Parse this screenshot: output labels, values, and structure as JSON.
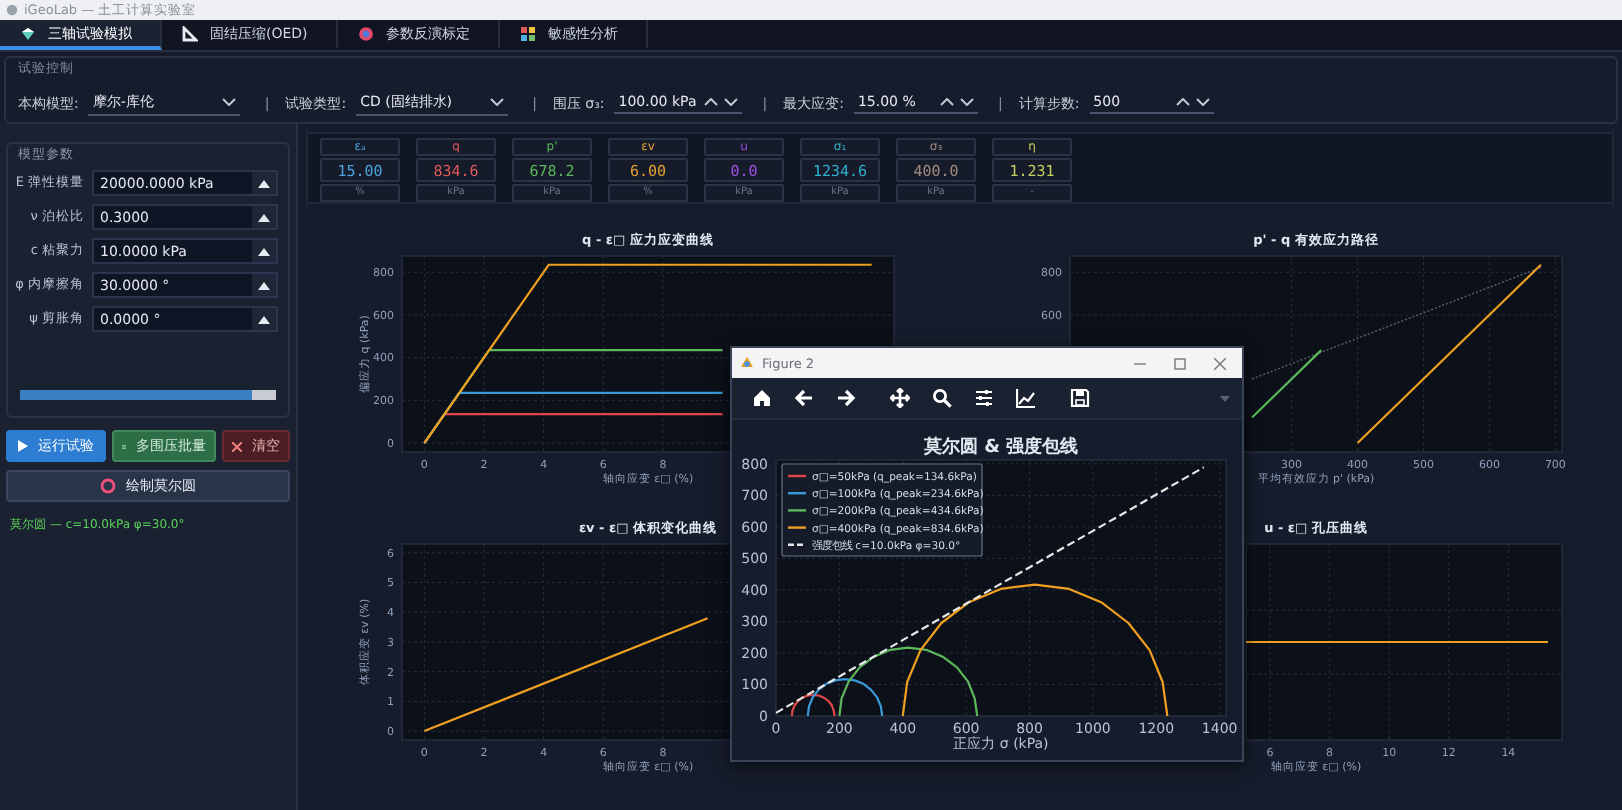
{
  "window": {
    "title": "iGeoLab — 土工计算实验室"
  },
  "tabs": [
    {
      "label": "三轴试验模拟",
      "selected": true
    },
    {
      "label": "固结压缩(OED)",
      "selected": false
    },
    {
      "label": "参数反演标定",
      "selected": false
    },
    {
      "label": "敏感性分析",
      "selected": false
    }
  ],
  "test_control": {
    "title": "试验控制",
    "fields": [
      {
        "kind": "dropdown",
        "label": "本构模型:",
        "value": "摩尔-库伦"
      },
      {
        "kind": "dropdown",
        "separator": "|",
        "label": "试验类型:",
        "value": "CD (固结排水)"
      },
      {
        "kind": "spinbox",
        "separator": "|",
        "label": "围压 σ₃:",
        "value": "100.00  kPa"
      },
      {
        "kind": "spinbox",
        "separator": "|",
        "label": "最大应变:",
        "value": "15.00  %"
      },
      {
        "kind": "spinbox",
        "separator": "|",
        "label": "计算步数:",
        "value": "500"
      }
    ]
  },
  "model_params": {
    "title": "模型参数",
    "rows": [
      {
        "label": "E  弹性模量",
        "value": "20000.0000  kPa"
      },
      {
        "label": "ν  泊松比",
        "value": "0.3000"
      },
      {
        "label": "c  粘聚力",
        "value": "10.0000  kPa"
      },
      {
        "label": "φ  内摩擦角",
        "value": "30.0000  °"
      },
      {
        "label": "ψ  剪胀角",
        "value": "0.0000  °"
      }
    ],
    "progress": {
      "level": 0.91
    }
  },
  "actions": [
    {
      "kind": "run",
      "label": "运行试验"
    },
    {
      "kind": "batch",
      "label": "多围压批量"
    },
    {
      "kind": "clear",
      "label": "清空"
    },
    {
      "kind": "mohr",
      "label": "绘制莫尔圆"
    }
  ],
  "status": "莫尔圆 — c=10.0kPa  φ=30.0°",
  "metrics": [
    {
      "label": "εₐ",
      "value": "15.00",
      "unit": "%",
      "color": "#4aa3df"
    },
    {
      "label": "q",
      "value": "834.6",
      "unit": "kPa",
      "color": "#e05a5a"
    },
    {
      "label": "p'",
      "value": "678.2",
      "unit": "kPa",
      "color": "#5cb85c"
    },
    {
      "label": "εv",
      "value": "6.00",
      "unit": "%",
      "color": "#e8a030"
    },
    {
      "label": "u",
      "value": "0.0",
      "unit": "kPa",
      "color": "#a050e0"
    },
    {
      "label": "σ₁",
      "value": "1234.6",
      "unit": "kPa",
      "color": "#30b0d0"
    },
    {
      "label": "σ₃",
      "value": "400.0",
      "unit": "kPa",
      "color": "#a08a80"
    },
    {
      "label": "η",
      "value": "1.231",
      "unit": "-",
      "color": "#c8d060"
    }
  ],
  "charts": [
    {
      "chart_data": {
        "type": "line",
        "title": "q - ε□  应力应变曲线",
        "xlabel": "轴向应变 ε□ (%)",
        "ylabel": "偏应力 q (kPa)",
        "grid": true,
        "xlim": [
          -0.75,
          15.75
        ],
        "ylim": [
          -42,
          876
        ],
        "xticks": [
          0,
          2,
          4,
          6,
          8
        ],
        "yticks": [
          0,
          200,
          400,
          600,
          800
        ],
        "series": [
          {
            "color": "#e04848",
            "x": [
              0,
              0.67,
              10
            ],
            "values": [
              0,
              135,
              135
            ]
          },
          {
            "color": "#3a9ad9",
            "x": [
              0,
              1.17,
              10
            ],
            "values": [
              0,
              235,
              235
            ]
          },
          {
            "color": "#5cb85c",
            "x": [
              0,
              2.17,
              10
            ],
            "values": [
              0,
              435,
              435
            ]
          },
          {
            "color": "#f0a020",
            "x": [
              0,
              4.17,
              15
            ],
            "values": [
              0,
              835,
              835
            ]
          }
        ]
      }
    },
    {
      "chart_data": {
        "type": "line",
        "title": "p' - q  有效应力路径",
        "xlabel": "平均有效应力 p' (kPa)",
        "grid": true,
        "xlim": [
          -36,
          710
        ],
        "ylim": [
          -42,
          876
        ],
        "xticks": [
          300,
          400,
          500,
          600,
          700
        ],
        "yticks": [
          600,
          800
        ],
        "series": [
          {
            "line_style": "dotted",
            "color": "#5a6272",
            "x": [
              240,
              680
            ],
            "values": [
              300,
              825
            ]
          },
          {
            "color": "#5cb85c",
            "x": [
              240,
              345
            ],
            "values": [
              120,
              435
            ]
          },
          {
            "color": "#f0a020",
            "x": [
              400,
              678
            ],
            "values": [
              0,
              835
            ]
          }
        ]
      }
    },
    {
      "chart_data": {
        "type": "line",
        "title": "εv - ε□  体积变化曲线",
        "xlabel": "轴向应变 ε□ (%)",
        "ylabel": "体积应变 εv (%)",
        "grid": true,
        "xlim": [
          -0.75,
          15.75
        ],
        "ylim": [
          -0.3,
          6.3
        ],
        "xticks": [
          0,
          2,
          4,
          6,
          8
        ],
        "yticks": [
          0,
          1,
          2,
          3,
          4,
          5,
          6
        ],
        "series": [
          {
            "color": "#f0a020",
            "x": [
              0,
              9.5
            ],
            "values": [
              0,
              3.8
            ]
          }
        ]
      }
    },
    {
      "title": "u - ε□  孔压曲线",
      "xlabel": "轴向应变 ε□ (%)",
      "axis_numbers": [
        {
          "text": "6"
        },
        {
          "text": "8"
        },
        {
          "text": "10"
        },
        {
          "text": "12"
        },
        {
          "text": "14"
        }
      ]
    }
  ],
  "figure": {
    "title": "Figure 2",
    "chart_data": {
      "type": "line",
      "title": "莫尔圆  &  强度包线",
      "xlabel": "正应力 σ (kPa)",
      "grid": true,
      "legend": "upper left",
      "xlim": [
        0,
        1420
      ],
      "ylim": [
        0,
        812
      ],
      "xticks": [
        0,
        200,
        400,
        600,
        800,
        1000,
        1200,
        1400
      ],
      "yticks": [
        0,
        100,
        200,
        300,
        400,
        500,
        600,
        700,
        800
      ],
      "series": [
        {
          "name": "σ□=50kPa (q_peak=134.6kPa)",
          "color": "#e04848",
          "x": [
            50,
            52,
            59,
            70,
            84,
            100,
            117,
            135,
            151,
            165,
            176,
            182,
            185
          ],
          "values": [
            0,
            17,
            34,
            48,
            58,
            65,
            67,
            65,
            58,
            48,
            34,
            17,
            0
          ]
        },
        {
          "name": "σ□=100kPa (q_peak=234.6kPa)",
          "color": "#3a9ad9",
          "x": [
            100,
            104,
            116,
            134,
            159,
            187,
            217,
            248,
            276,
            300,
            319,
            331,
            335
          ],
          "values": [
            0,
            30,
            59,
            83,
            102,
            113,
            117,
            113,
            102,
            83,
            59,
            30,
            0
          ]
        },
        {
          "name": "σ□=200kPa (q_peak=434.6kPa)",
          "color": "#5cb85c",
          "x": [
            200,
            207,
            229,
            264,
            309,
            361,
            417,
            474,
            526,
            571,
            606,
            627,
            635
          ],
          "values": [
            0,
            56,
            109,
            154,
            188,
            210,
            217,
            210,
            188,
            154,
            109,
            56,
            0
          ]
        },
        {
          "name": "σ□=400kPa (q_peak=834.6kPa)",
          "color": "#f0a020",
          "x": [
            400,
            414,
            456,
            522,
            609,
            709,
            817,
            925,
            1026,
            1112,
            1179,
            1220,
            1235
          ],
          "values": [
            0,
            108,
            209,
            295,
            361,
            403,
            417,
            403,
            361,
            295,
            209,
            108,
            0
          ]
        },
        {
          "name": "强度包线  c=10.0kPa  φ=30.0°",
          "line_style": "dashed",
          "color": "#e8e8e8",
          "x": [
            0,
            1350
          ],
          "values": [
            10,
            789
          ]
        }
      ]
    }
  }
}
